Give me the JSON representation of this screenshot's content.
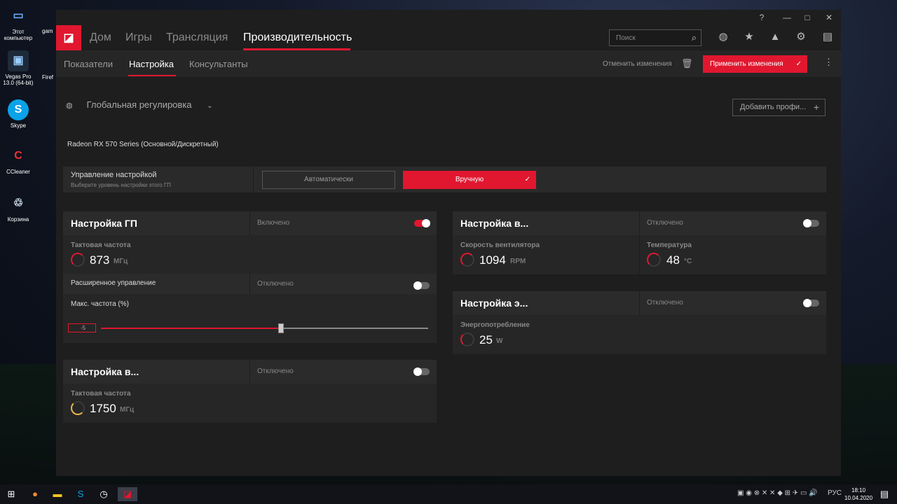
{
  "desktop": {
    "icons": [
      {
        "label": "Этот компьютер",
        "glyph": "▭"
      },
      {
        "label": "Vegas Pro 13.0 (64-bit)",
        "glyph": "▣"
      },
      {
        "label": "Skype",
        "glyph": "S"
      },
      {
        "label": "CCleaner",
        "glyph": "C"
      },
      {
        "label": "Корзина",
        "glyph": "♲"
      }
    ],
    "partial": [
      "gam",
      "Firef"
    ]
  },
  "window": {
    "buttons": {
      "help": "?",
      "minimize": "—",
      "maximize": "□",
      "close": "✕"
    }
  },
  "nav": {
    "logo": "◪",
    "tabs": [
      "Дом",
      "Игры",
      "Трансляция",
      "Производительность"
    ],
    "search_placeholder": "Поиск",
    "search_icon": "⌕"
  },
  "subnav": {
    "tabs": [
      "Показатели",
      "Настройка",
      "Консультанты"
    ],
    "discard": "Отменить изменения",
    "apply": "Применить изменения",
    "check": "✓",
    "kebab": "⋮"
  },
  "profile": {
    "name": "Глобальная регулировка",
    "add": "Добавить профи...",
    "plus": "+",
    "chevron": "⌄"
  },
  "gpu": "Radeon RX 570 Series (Основной/Дискретный)",
  "control": {
    "title": "Управление настройкой",
    "subtitle": "Выберите уровень настройки этого ГП",
    "auto": "Автоматически",
    "manual": "Вручную"
  },
  "gpu_panel": {
    "title": "Настройка ГП",
    "state": "Включено",
    "metric_label": "Тактовая частота",
    "value": "873",
    "unit": "МГц",
    "adv_label": "Расширенное управление",
    "adv_state": "Отключено",
    "maxfreq_label": "Макс. частота (%)",
    "slider_value": "-5",
    "slider_fraction": 0.55
  },
  "vram_panel": {
    "title": "Настройка в...",
    "state": "Отключено",
    "metric_label": "Тактовая частота",
    "value": "1750",
    "unit": "МГц"
  },
  "fan_panel": {
    "title": "Настройка в...",
    "state": "Отключено",
    "fan_label": "Скорость вентилятора",
    "fan_value": "1094",
    "fan_unit": "RPM",
    "temp_label": "Температура",
    "temp_value": "48",
    "temp_unit": "°C"
  },
  "power_panel": {
    "title": "Настройка э...",
    "state": "Отключено",
    "metric_label": "Энергопотребление",
    "value": "25",
    "unit": "W"
  },
  "taskbar": {
    "lang": "РУС",
    "time": "18:10",
    "date": "10.04.2020"
  }
}
